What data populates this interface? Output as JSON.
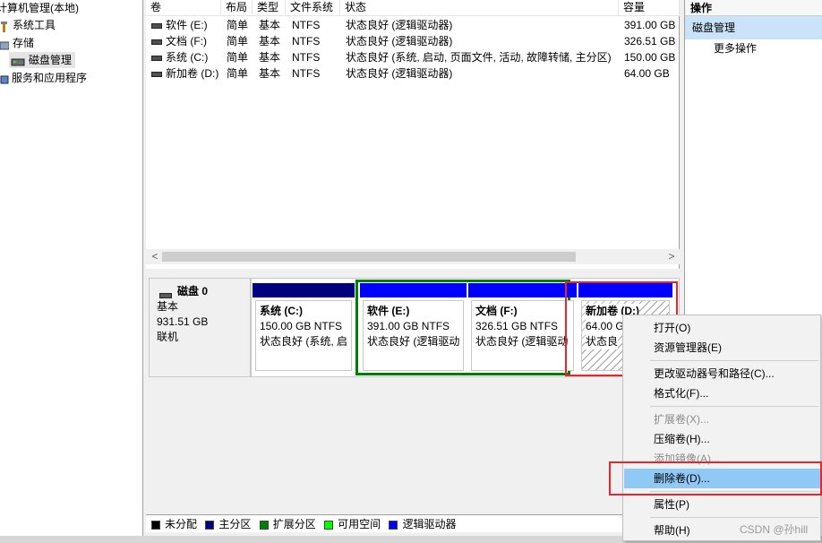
{
  "tree": {
    "root": "计算机管理(本地)",
    "items": [
      "系统工具",
      "存储",
      "磁盘管理",
      "服务和应用程序"
    ]
  },
  "list": {
    "columns": [
      "卷",
      "布局",
      "类型",
      "文件系统",
      "状态",
      "容量"
    ],
    "rows": [
      {
        "name": "软件 (E:)",
        "layout": "简单",
        "type": "基本",
        "fs": "NTFS",
        "status": "状态良好 (逻辑驱动器)",
        "capacity": "391.00 GB"
      },
      {
        "name": "文档 (F:)",
        "layout": "简单",
        "type": "基本",
        "fs": "NTFS",
        "status": "状态良好 (逻辑驱动器)",
        "capacity": "326.51 GB"
      },
      {
        "name": "系统 (C:)",
        "layout": "简单",
        "type": "基本",
        "fs": "NTFS",
        "status": "状态良好 (系统, 启动, 页面文件, 活动, 故障转储, 主分区)",
        "capacity": "150.00 GB"
      },
      {
        "name": "新加卷 (D:)",
        "layout": "简单",
        "type": "基本",
        "fs": "NTFS",
        "status": "状态良好 (逻辑驱动器)",
        "capacity": "64.00 GB"
      }
    ],
    "scroll_left": "<",
    "scroll_right": ">"
  },
  "disk": {
    "name": "磁盘 0",
    "type": "基本",
    "size": "931.51 GB",
    "state": "联机",
    "partitions": [
      {
        "title": "系统  (C:)",
        "size": "150.00 GB NTFS",
        "status": "状态良好 (系统, 启",
        "bar": "#00007f"
      },
      {
        "title": "软件  (E:)",
        "size": "391.00 GB NTFS",
        "status": "状态良好 (逻辑驱动",
        "bar": "#0000ff"
      },
      {
        "title": "文档  (F:)",
        "size": "326.51 GB NTFS",
        "status": "状态良好 (逻辑驱动",
        "bar": "#0000ff"
      },
      {
        "title": "新加卷  (D:)",
        "size": "64.00 G",
        "status": "状态良",
        "bar": "#0000ff"
      }
    ]
  },
  "legend": [
    {
      "label": "未分配",
      "color": "#000000"
    },
    {
      "label": "主分区",
      "color": "#00007f"
    },
    {
      "label": "扩展分区",
      "color": "#008000"
    },
    {
      "label": "可用空间",
      "color": "#00ff00"
    },
    {
      "label": "逻辑驱动器",
      "color": "#0000ff"
    }
  ],
  "actions": {
    "title": "操作",
    "selected": "磁盘管理",
    "more": "更多操作"
  },
  "context_menu": {
    "items": [
      {
        "label": "打开(O)",
        "enabled": true
      },
      {
        "label": "资源管理器(E)",
        "enabled": true
      },
      {
        "label": "更改驱动器号和路径(C)...",
        "enabled": true
      },
      {
        "label": "格式化(F)...",
        "enabled": true
      },
      {
        "label": "扩展卷(X)...",
        "enabled": false
      },
      {
        "label": "压缩卷(H)...",
        "enabled": true
      },
      {
        "label": "添加镜像(A)...",
        "enabled": false
      },
      {
        "label": "删除卷(D)...",
        "enabled": true,
        "highlighted": true
      },
      {
        "label": "属性(P)",
        "enabled": true
      },
      {
        "label": "帮助(H)",
        "enabled": true
      }
    ]
  },
  "watermark": "CSDN @孙hill",
  "colors": {
    "highlight_red": "#e8242c",
    "extended_green": "#008000",
    "menu_highlight": "#90c8f6"
  }
}
